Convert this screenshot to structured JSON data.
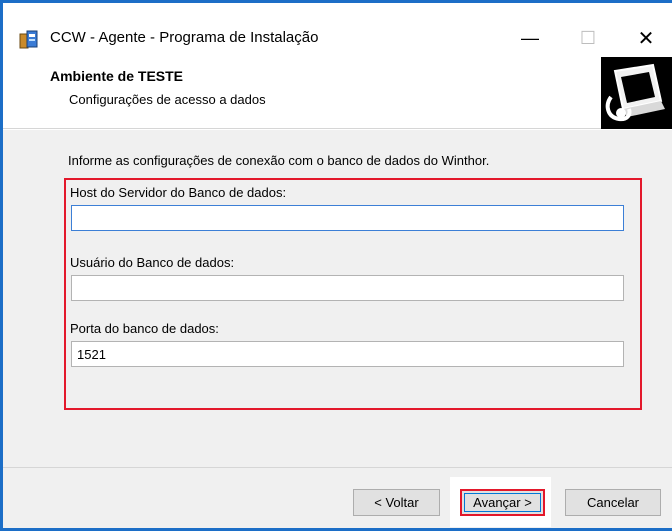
{
  "window": {
    "title": "CCW - Agente - Programa de Instalação",
    "minimize_glyph": "—",
    "maximize_glyph": "☐",
    "close_glyph": "✕",
    "icon": "installer-icon",
    "frame_color": "#1c6ec7"
  },
  "header": {
    "title": "Ambiente de TESTE",
    "subtitle": "Configurações de acesso a dados",
    "logo_icon": "computer-logo-icon"
  },
  "main": {
    "intro": "Informe as configurações de conexão com o banco de dados do Winthor.",
    "highlight_color": "#e3182b",
    "fields": [
      {
        "label": "Host do Servidor do Banco de dados:",
        "value": ""
      },
      {
        "label": "Usuário do Banco de dados:",
        "value": ""
      },
      {
        "label": "Porta do banco de dados:",
        "value": "1521"
      }
    ]
  },
  "footer": {
    "back_label": "< Voltar",
    "next_label": "Avançar >",
    "cancel_label": "Cancelar"
  }
}
